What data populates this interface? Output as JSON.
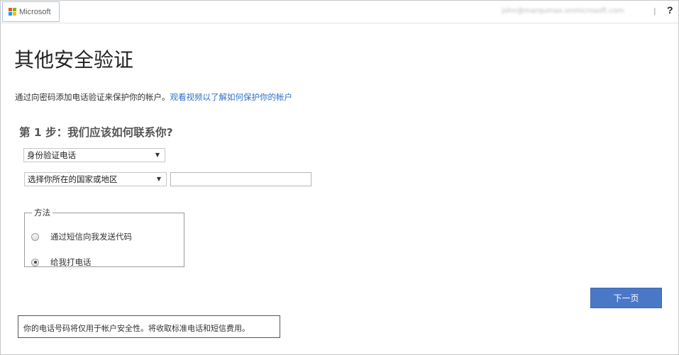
{
  "header": {
    "brand": "Microsoft",
    "user_email": "john@marqumax.onmicrosoft.com",
    "separator": "|",
    "help": "?"
  },
  "page": {
    "title": "其他安全验证",
    "intro_text": "通过向密码添加电话验证来保护你的帐户。",
    "intro_link": "观看视频以了解如何保护你的帐户",
    "step_title": "第 1 步：我们应该如何联系你?"
  },
  "form": {
    "method_select": "身份验证电话",
    "country_select": "选择你所在的国家或地区",
    "phone_value": "",
    "dropdown_arrow": "▼",
    "method_group": {
      "legend": "方法",
      "options": [
        {
          "label": "通过短信向我发送代码",
          "checked": false
        },
        {
          "label": "给我打电话",
          "checked": true
        }
      ]
    },
    "next_button": "下一页",
    "note": "你的电话号码将仅用于帐户安全性。将收取标准电话和短信费用。"
  },
  "colors": {
    "accent": "#4a78c7",
    "link": "#2f6fc4",
    "ms_red": "#f25022",
    "ms_green": "#7fba00",
    "ms_blue": "#00a4ef",
    "ms_yellow": "#ffb900"
  }
}
